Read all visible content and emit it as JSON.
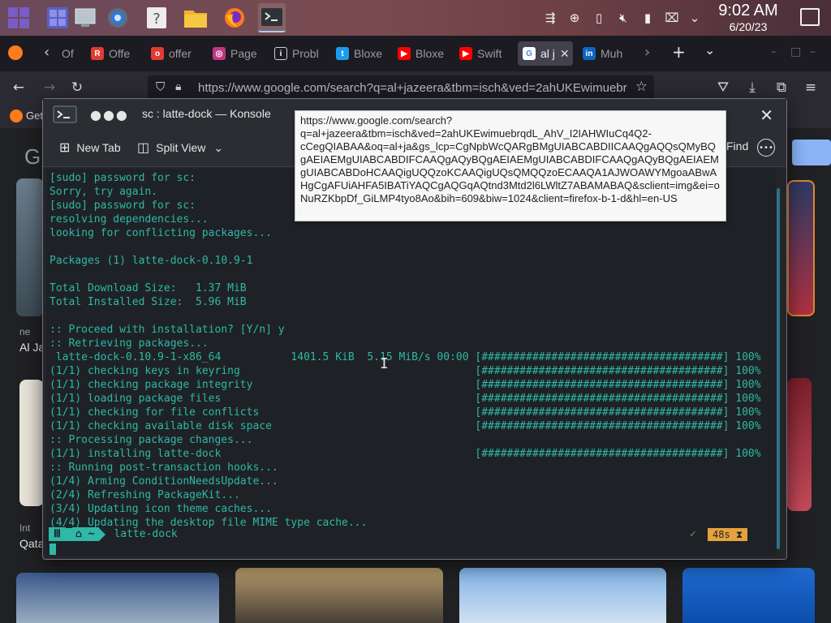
{
  "panel": {
    "clock_time": "9:02 AM",
    "clock_date": "6/20/23"
  },
  "firefox": {
    "tabs": [
      {
        "label": "Of",
        "icon": "back-icon"
      },
      {
        "label": "Offe",
        "icon": "redbubble-icon"
      },
      {
        "label": "offer",
        "icon": "offer-icon"
      },
      {
        "label": "Page",
        "icon": "instagram-icon"
      },
      {
        "label": "Probl",
        "icon": "info-icon"
      },
      {
        "label": "Bloxe",
        "icon": "twitter-icon"
      },
      {
        "label": "Bloxe",
        "icon": "youtube-icon"
      },
      {
        "label": "Swift",
        "icon": "youtube-icon"
      },
      {
        "label": "al j",
        "icon": "google-icon"
      },
      {
        "label": "Muh",
        "icon": "linkedin-icon"
      }
    ],
    "url": "https://www.google.com/search?q=al+jazeera&tbm=isch&ved=2ahUKEwimuebr",
    "bookmark_label": "Get",
    "page_label_left_1": "ne",
    "page_label_left_2": "Al Ja",
    "page_label_left_3": "Int",
    "page_label_left_4": "Qata"
  },
  "konsole": {
    "title": "sc : latte-dock — Konsole",
    "new_tab_label": "New Tab",
    "split_view_label": "Split View",
    "find_label": "Find",
    "tooltip": "https://www.google.com/search?q=al+jazeera&tbm=isch&ved=2ahUKEwimuebrqdL_AhV_I2IAHWIuCq4Q2-cCegQIABAA&oq=al+ja&gs_lcp=CgNpbWcQARgBMgUIABCABDIICAAQgAQQsQMyBQgAEIAEMgUIABCABDIFCAAQgAQyBQgAEIAEMgUIABCABDIFCAAQgAQyBQgAEIAEMgUIABCABDoHCAAQigUQQzoKCAAQigUQsQMQQzoECAAQA1AJWOAWYMgoaABwAHgCgAFUiAHFA5IBATiYAQCgAQGqAQtnd3Mtd2l6LWltZ7ABAMABAQ&sclient=img&ei=oNuRZKbpDf_GiLMP4tyo8Ao&bih=609&biw=1024&client=firefox-b-1-d&hl=en-US",
    "lines": [
      "[sudo] password for sc:",
      "Sorry, try again.",
      "[sudo] password for sc:",
      "resolving dependencies...",
      "looking for conflicting packages...",
      "",
      "Packages (1) latte-dock-0.10.9-1",
      "",
      "Total Download Size:   1.37 MiB",
      "Total Installed Size:  5.96 MiB",
      "",
      ":: Proceed with installation? [Y/n] y",
      ":: Retrieving packages...",
      " latte-dock-0.10.9-1-x86_64           1401.5 KiB  5.15 MiB/s 00:00 [######################################] 100%",
      "(1/1) checking keys in keyring                                     [######################################] 100%",
      "(1/1) checking package integrity                                   [######################################] 100%",
      "(1/1) loading package files                                        [######################################] 100%",
      "(1/1) checking for file conflicts                                  [######################################] 100%",
      "(1/1) checking available disk space                                [######################################] 100%",
      ":: Processing package changes...",
      "(1/1) installing latte-dock                                        [######################################] 100%",
      ":: Running post-transaction hooks...",
      "(1/4) Arming ConditionNeedsUpdate...",
      "(2/4) Refreshing PackageKit...",
      "(3/4) Updating icon theme caches...",
      "(4/4) Updating the desktop file MIME type cache..."
    ],
    "prompt_seg1": "Ⅲ",
    "prompt_seg2": "⌂ ~",
    "prompt_command": "latte-dock",
    "prompt_check": "✓",
    "timer": "48s ⧗"
  },
  "colors": {
    "terminal_text": "#2fb8a5",
    "timer_bg": "#e6a23c",
    "accent": "#9fd3ff"
  }
}
